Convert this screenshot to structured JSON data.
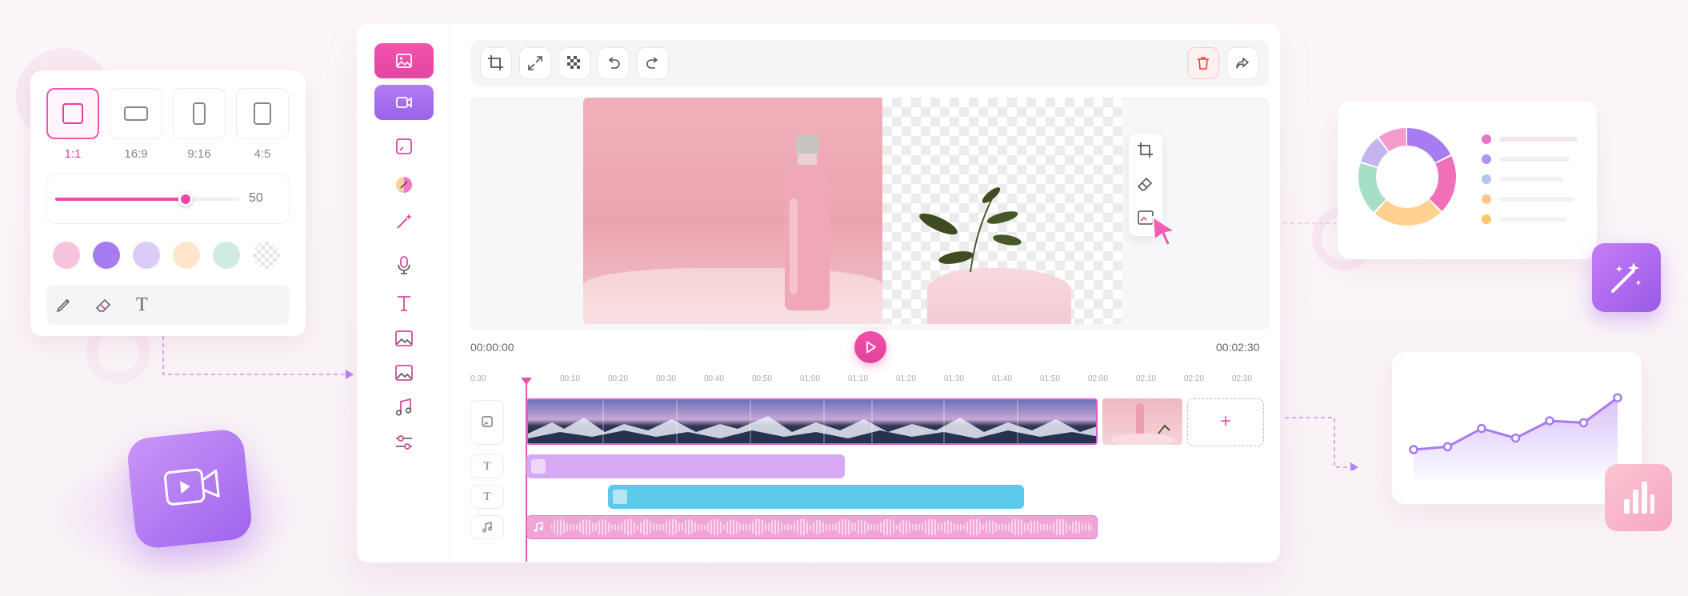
{
  "ratio_panel": {
    "options": [
      {
        "label": "1:1",
        "active": true
      },
      {
        "label": "16:9",
        "active": false
      },
      {
        "label": "9:16",
        "active": false
      },
      {
        "label": "4:5",
        "active": false
      }
    ],
    "slider": {
      "value_text": "50",
      "value": 0.71
    },
    "swatches": [
      "#f8c3dc",
      "#a77cf0",
      "#dcccf8",
      "#fde7cc",
      "#cfecdf",
      "checker"
    ],
    "tools": [
      "pencil-icon",
      "eraser-icon",
      "text-icon"
    ],
    "tool_text_glyph": "T"
  },
  "editor": {
    "sidebar": [
      "image-icon",
      "video-icon",
      "crop-frame-icon",
      "color-icon",
      "magic-wand-icon",
      "microphone-icon",
      "text-icon",
      "image-icon",
      "image-icon",
      "music-icon",
      "sliders-icon"
    ],
    "toolbar": [
      "crop-icon",
      "expand-icon",
      "transparency-icon",
      "undo-icon",
      "redo-icon"
    ],
    "toolbar_right": [
      "delete-icon",
      "share-icon"
    ],
    "floating_tools": [
      "crop-icon",
      "eraser-icon",
      "image-cutout-icon"
    ],
    "time_start": "00:00:00",
    "time_end": "00:02:30",
    "ruler": [
      "0:30",
      "00:10",
      "00:20",
      "00:30",
      "00:40",
      "00:50",
      "01:00",
      "01:10",
      "01:20",
      "01:30",
      "01:40",
      "01:50",
      "02:00",
      "02:10",
      "02:20",
      "02:30"
    ],
    "track_labels": [
      "image-track-icon",
      "T",
      "T",
      "music-track-icon"
    ],
    "add_clip_label": "+"
  },
  "donut_card": {
    "segments": [
      {
        "color": "#a77cf0",
        "value": 18
      },
      {
        "color": "#ef6fb9",
        "value": 20
      },
      {
        "color": "#ffd08e",
        "value": 24
      },
      {
        "color": "#a6dfc6",
        "value": 18
      },
      {
        "color": "#c6b4ee",
        "value": 10
      },
      {
        "color": "#f29ccb",
        "value": 10
      }
    ],
    "legend_colors": [
      "#e576c6",
      "#b493ef",
      "#b7c4ec",
      "#fdc58a",
      "#fdc861"
    ]
  },
  "line_card": {
    "chart_data": {
      "type": "area",
      "values": [
        30,
        33,
        52,
        42,
        60,
        58,
        84
      ],
      "color": "#a979f0"
    }
  }
}
